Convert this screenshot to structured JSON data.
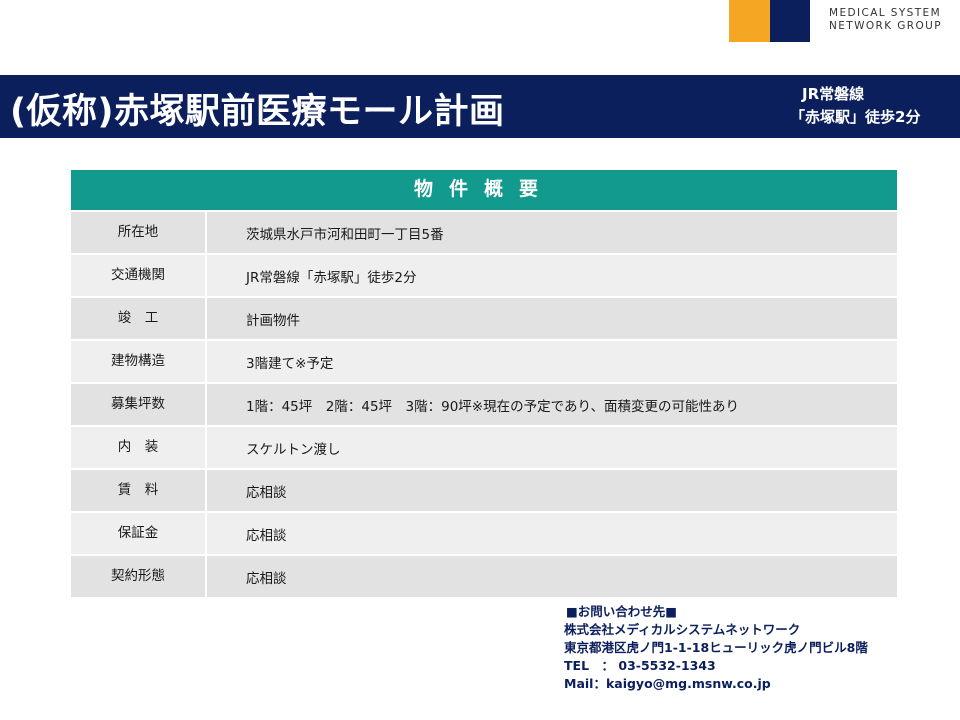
{
  "logo": {
    "line1": "MEDICAL SYSTEM",
    "line2": "NETWORK GROUP",
    "colors": {
      "orange": "#f5a623",
      "navy": "#0b1f5c"
    }
  },
  "header": {
    "title": "(仮称)赤塚駅前医療モール計画",
    "subtitle_line1": "JR常磐線",
    "subtitle_line2": "「赤塚駅」徒歩2分"
  },
  "table": {
    "title": "物件概要",
    "rows": [
      {
        "label": "所在地",
        "value": "茨城県水戸市河和田町一丁目5番"
      },
      {
        "label": "交通機関",
        "value": "JR常磐線「赤塚駅」徒歩2分"
      },
      {
        "label": "竣　工",
        "value": "計画物件"
      },
      {
        "label": "建物構造",
        "value": "3階建て※予定"
      },
      {
        "label": "募集坪数",
        "value": "1階：45坪　2階：45坪　3階：90坪※現在の予定であり、面積変更の可能性あり"
      },
      {
        "label": "内　装",
        "value": "スケルトン渡し"
      },
      {
        "label": "賃　料",
        "value": "応相談"
      },
      {
        "label": "保証金",
        "value": "応相談"
      },
      {
        "label": "契約形態",
        "value": "応相談"
      }
    ]
  },
  "contact": {
    "heading": "■お問い合わせ先■",
    "company": "株式会社メディカルシステムネットワーク",
    "address": "東京都港区虎ノ門1-1-18ヒューリック虎ノ門ビル8階",
    "tel": "TEL　：  03-5532-1343",
    "mail": "Mail：kaigyo@mg.msnw.co.jp"
  },
  "colors": {
    "header_bg": "#0b1f5c",
    "table_header_bg": "#129a8e",
    "row_bg_a": "#e2e2e2",
    "row_bg_b": "#efefef"
  }
}
